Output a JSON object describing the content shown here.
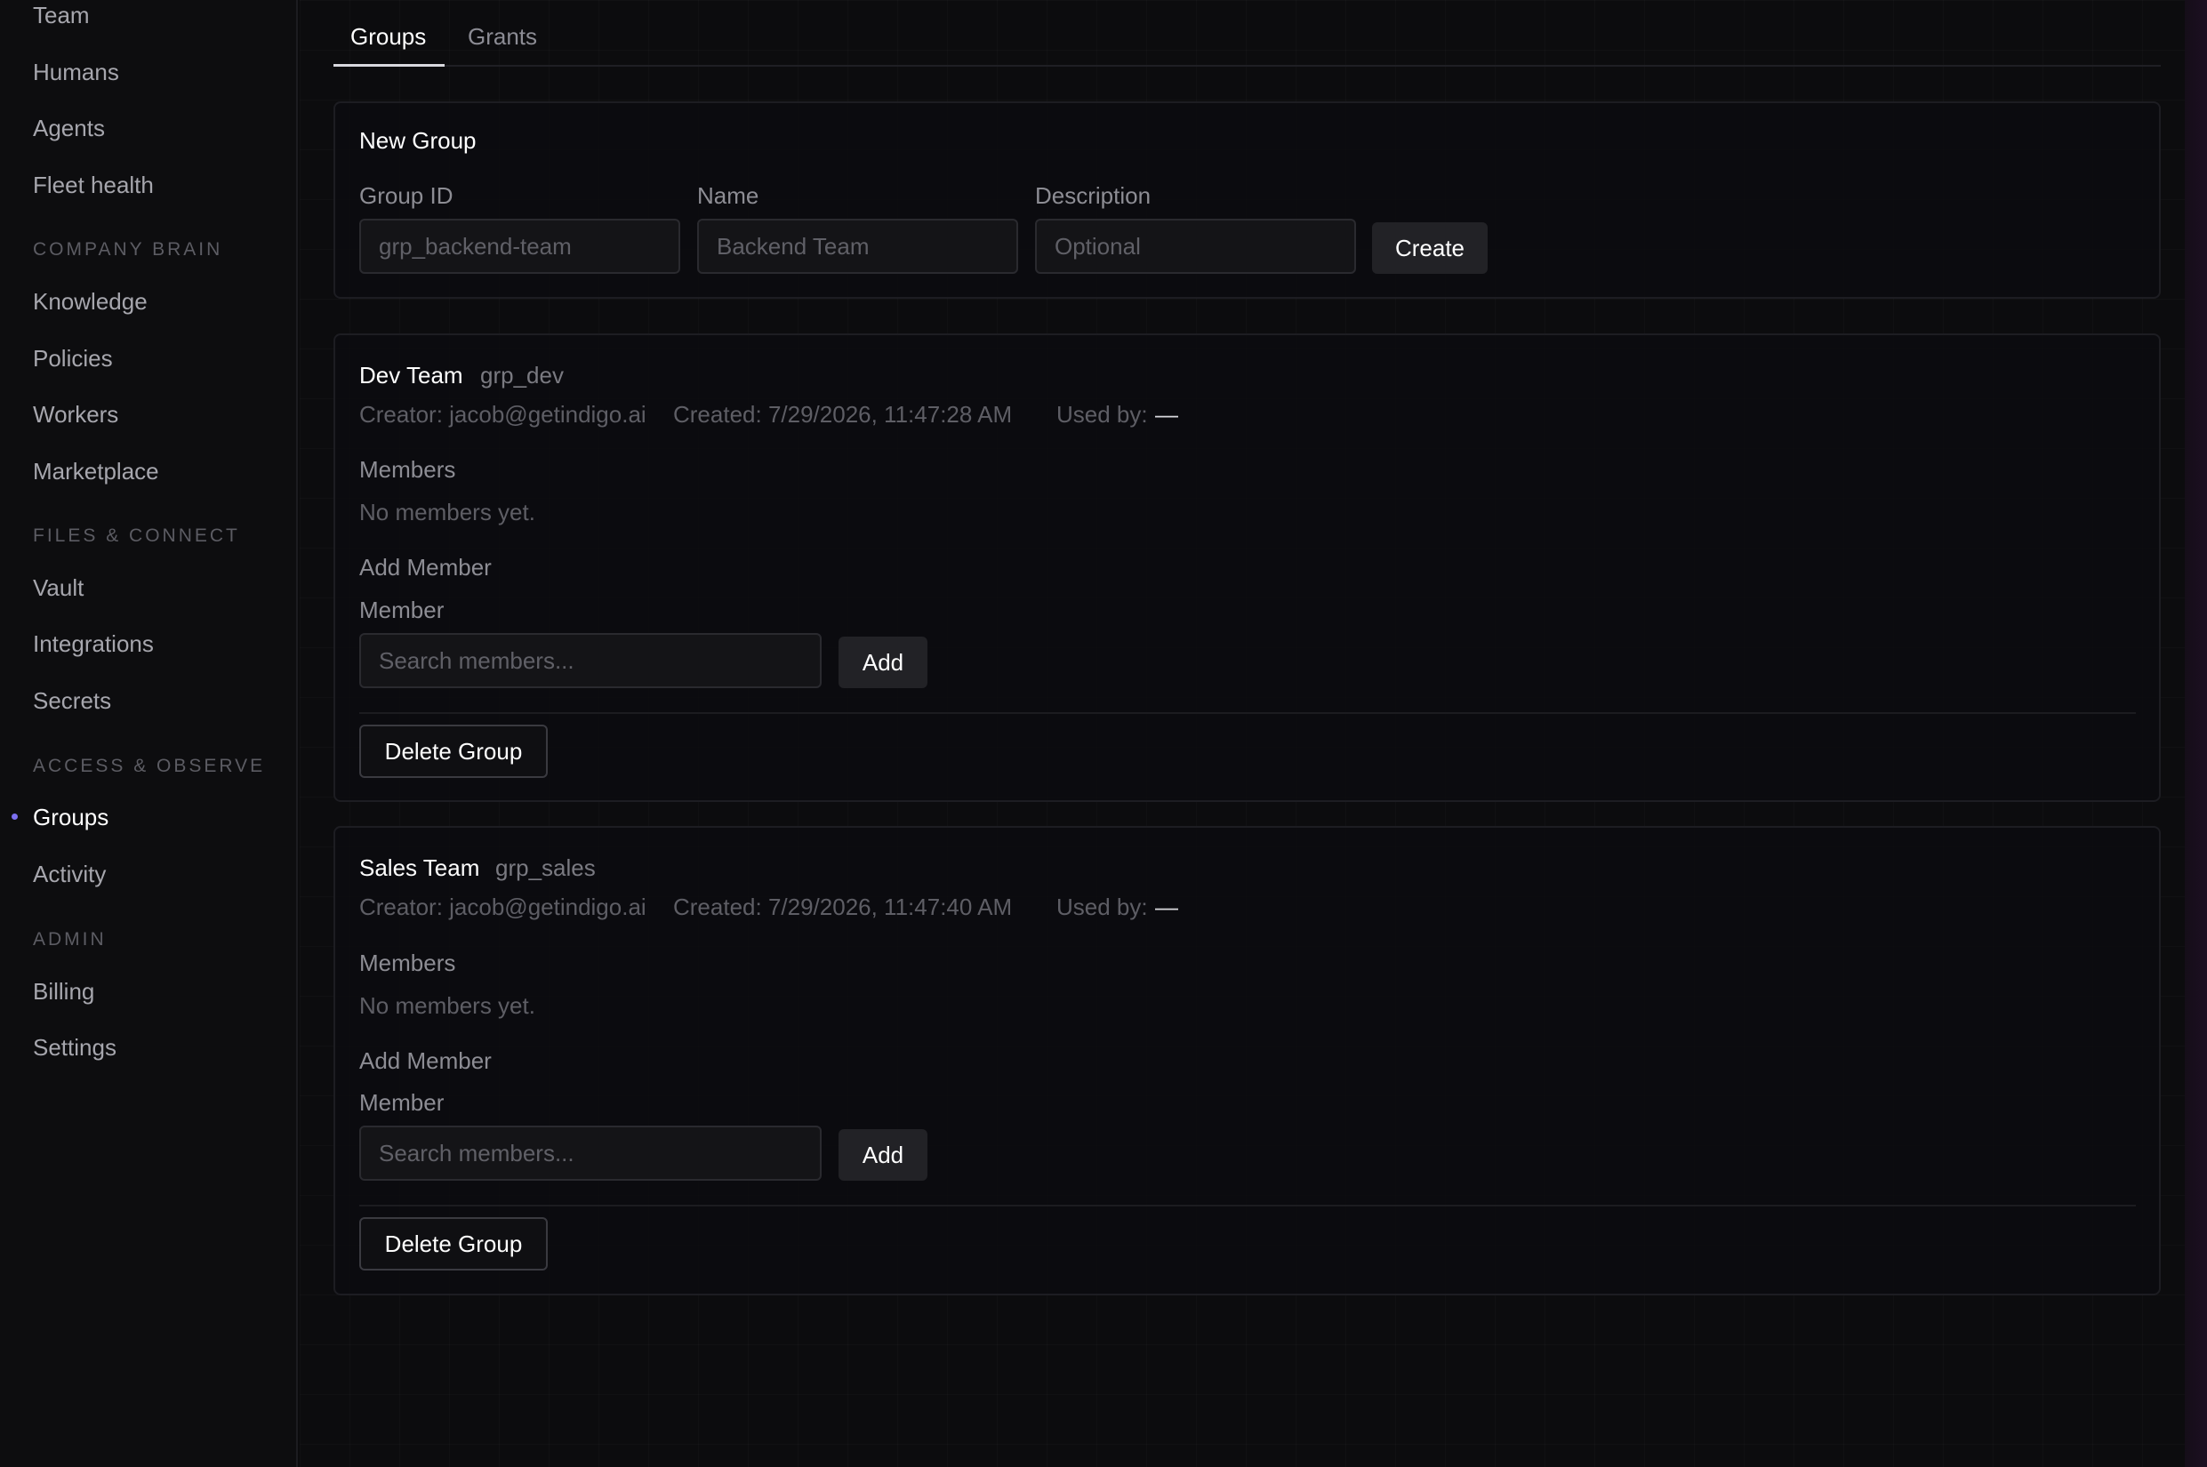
{
  "sidebar": {
    "items_top": [
      {
        "label": "Team"
      },
      {
        "label": "Humans"
      },
      {
        "label": "Agents"
      },
      {
        "label": "Fleet health"
      }
    ],
    "sections": [
      {
        "label": "COMPANY BRAIN",
        "items": [
          {
            "label": "Knowledge"
          },
          {
            "label": "Policies"
          },
          {
            "label": "Workers"
          },
          {
            "label": "Marketplace"
          }
        ]
      },
      {
        "label": "FILES & CONNECT",
        "items": [
          {
            "label": "Vault"
          },
          {
            "label": "Integrations"
          },
          {
            "label": "Secrets"
          }
        ]
      },
      {
        "label": "ACCESS & OBSERVE",
        "items": [
          {
            "label": "Groups"
          },
          {
            "label": "Activity"
          }
        ]
      },
      {
        "label": "ADMIN",
        "items": [
          {
            "label": "Billing"
          },
          {
            "label": "Settings"
          }
        ]
      }
    ],
    "active_item": "Groups",
    "accent_color": "#7c6ff0"
  },
  "tabs": [
    {
      "label": "Groups",
      "active": true
    },
    {
      "label": "Grants",
      "active": false
    }
  ],
  "new_group": {
    "title": "New Group",
    "fields": [
      {
        "label": "Group ID",
        "placeholder": "grp_backend-team",
        "value": ""
      },
      {
        "label": "Name",
        "placeholder": "Backend Team",
        "value": ""
      },
      {
        "label": "Description",
        "placeholder": "Optional",
        "value": ""
      }
    ],
    "create_label": "Create"
  },
  "groups": [
    {
      "name": "Dev Team",
      "id": "grp_dev",
      "creator": "Creator: jacob@getindigo.ai",
      "created": "Created: 7/29/2026, 11:47:28 AM",
      "used_by_label": "Used by:",
      "used_by_value": "—",
      "members_label": "Members",
      "members_empty": "No members yet.",
      "add_member_label": "Add Member",
      "member_field_label": "Member",
      "member_placeholder": "Search members...",
      "add_label": "Add",
      "delete_label": "Delete Group"
    },
    {
      "name": "Sales Team",
      "id": "grp_sales",
      "creator": "Creator: jacob@getindigo.ai",
      "created": "Created: 7/29/2026, 11:47:40 AM",
      "used_by_label": "Used by:",
      "used_by_value": "—",
      "members_label": "Members",
      "members_empty": "No members yet.",
      "add_member_label": "Add Member",
      "member_field_label": "Member",
      "member_placeholder": "Search members...",
      "add_label": "Add",
      "delete_label": "Delete Group"
    }
  ]
}
